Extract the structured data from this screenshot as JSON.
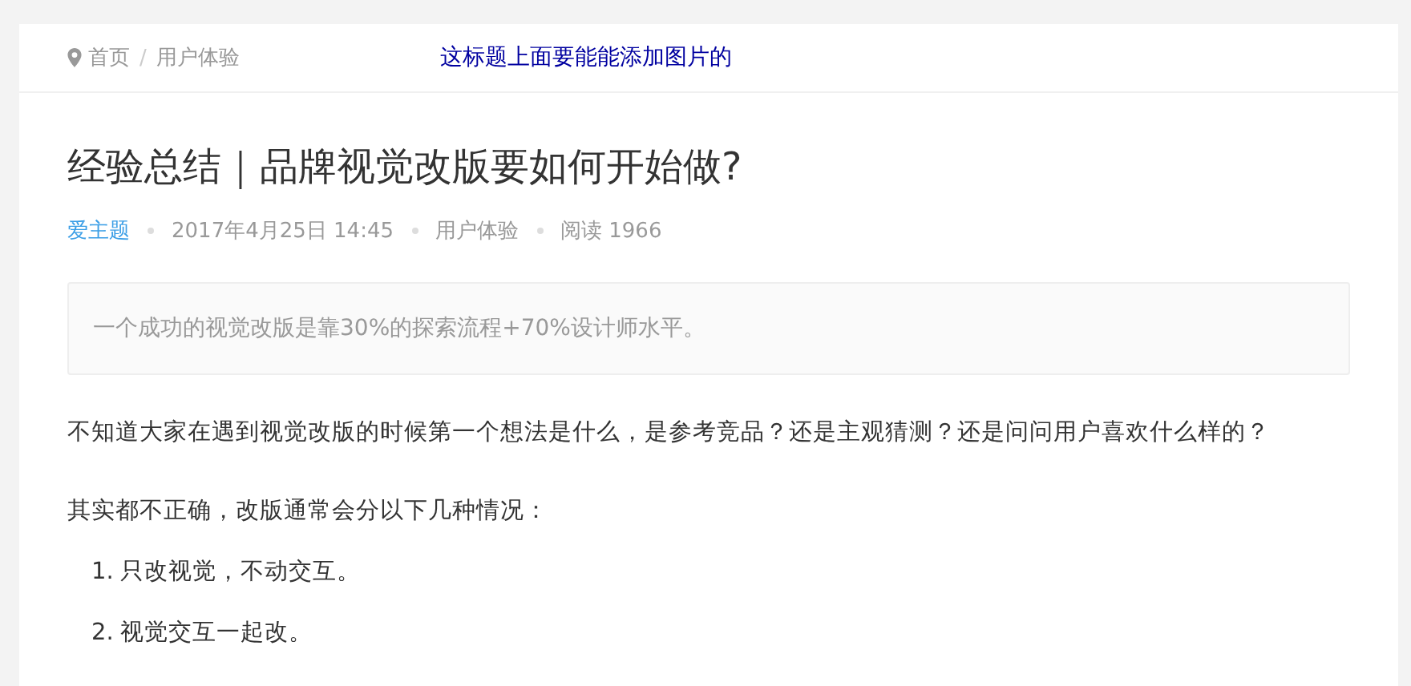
{
  "breadcrumb": {
    "items": [
      "首页",
      "用户体验"
    ],
    "separator": "/"
  },
  "annotation": "这标题上面要能能添加图片的",
  "article": {
    "title": "经验总结｜品牌视觉改版要如何开始做?",
    "meta": {
      "author": "爱主题",
      "date": "2017年4月25日 14:45",
      "category": "用户体验",
      "views": "阅读 1966"
    },
    "quote": "一个成功的视觉改版是靠30%的探索流程+70%设计师水平。",
    "paragraphs": [
      "不知道大家在遇到视觉改版的时候第一个想法是什么，是参考竞品？还是主观猜测？还是问问用户喜欢什么样的？",
      "其实都不正确，改版通常会分以下几种情况："
    ],
    "list": [
      {
        "number": "1.",
        "text": "只改视觉，不动交互。"
      },
      {
        "number": "2.",
        "text": "视觉交互一起改。"
      }
    ]
  }
}
